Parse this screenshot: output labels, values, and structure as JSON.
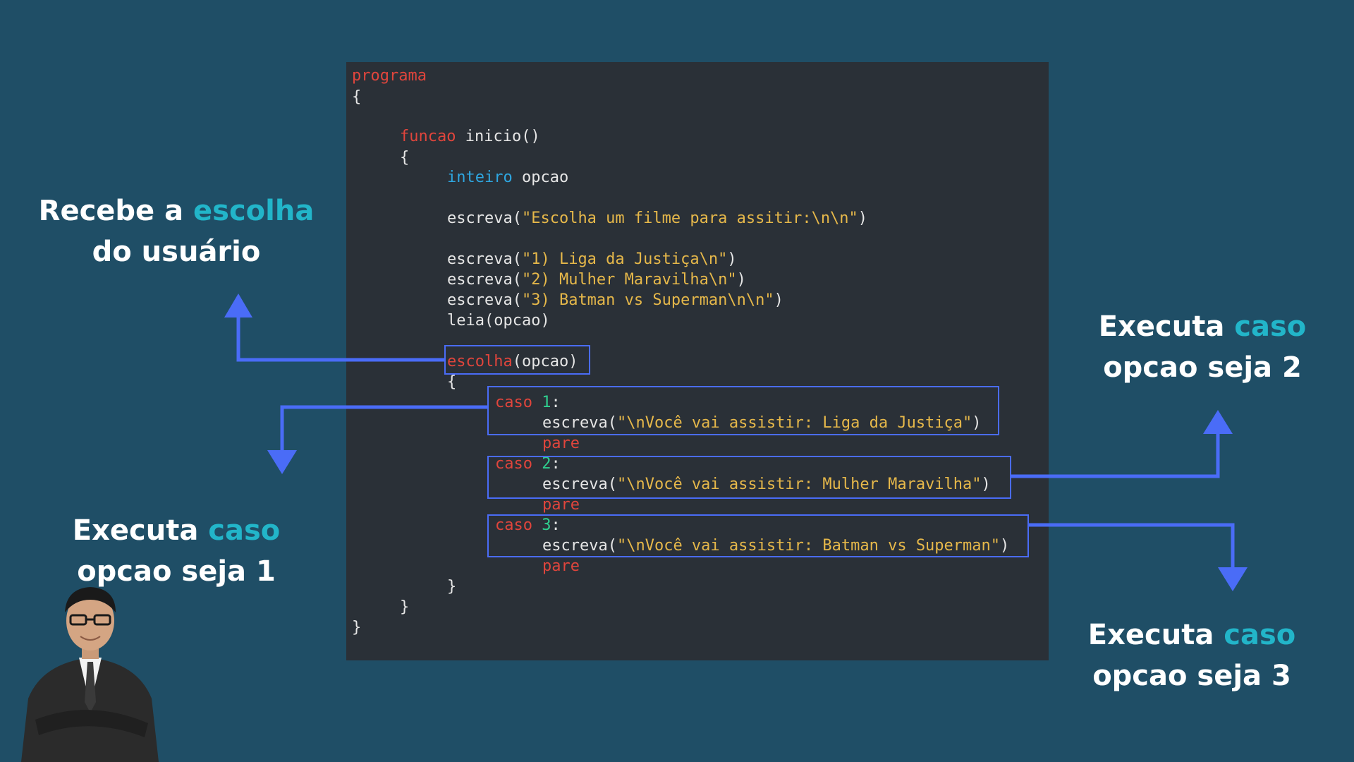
{
  "code": {
    "l1": "programa",
    "l2": "{",
    "l3_kw": "funcao",
    "l3_rest": " inicio()",
    "l4": "{",
    "l5_kw": "inteiro",
    "l5_rest": " opcao",
    "l6_fn": "escreva(",
    "l6_str": "\"Escolha um filme para assitir:\\n\\n\"",
    "l6_end": ")",
    "l7_fn": "escreva(",
    "l7_str": "\"1) Liga da Justiça\\n\"",
    "l7_end": ")",
    "l8_fn": "escreva(",
    "l8_str": "\"2) Mulher Maravilha\\n\"",
    "l8_end": ")",
    "l9_fn": "escreva(",
    "l9_str": "\"3) Batman vs Superman\\n\\n\"",
    "l9_end": ")",
    "l10": "leia(opcao)",
    "l11_kw": "escolha",
    "l11_rest": "(opcao)",
    "l12": "{",
    "case1_kw": "caso",
    "case1_num": "1",
    "case1_colon": ":",
    "case1_fn": "escreva(",
    "case1_str": "\"\\nVocê vai assistir: Liga da Justiça\"",
    "case1_end": ")",
    "pare1": "pare",
    "case2_kw": "caso",
    "case2_num": "2",
    "case2_colon": ":",
    "case2_fn": "escreva(",
    "case2_str": "\"\\nVocê vai assistir: Mulher Maravilha\"",
    "case2_end": ")",
    "pare2": "pare",
    "case3_kw": "caso",
    "case3_num": "3",
    "case3_colon": ":",
    "case3_fn": "escreva(",
    "case3_str": "\"\\nVocê vai assistir: Batman vs Superman\"",
    "case3_end": ")",
    "pare3": "pare",
    "close1": "}",
    "close2": "}",
    "close3": "}"
  },
  "labels": {
    "escolha": {
      "p1": "Recebe a ",
      "accent": "escolha",
      "p2": "do usuário"
    },
    "caso1": {
      "p1": "Executa ",
      "accent": "caso",
      "p2": "opcao seja 1"
    },
    "caso2": {
      "p1": "Executa ",
      "accent": "caso",
      "p2": "opcao seja 2"
    },
    "caso3": {
      "p1": "Executa ",
      "accent": "caso",
      "p2": "opcao seja 3"
    }
  },
  "colors": {
    "background": "#1f4e66",
    "code_background": "#2a3037",
    "keyword_red": "#e0453c",
    "keyword_blue": "#2ea6e0",
    "string": "#e6b84a",
    "number": "#2fd08f",
    "arrow": "#4a6cf7",
    "accent_text": "#22b5c9"
  },
  "icons": {
    "arrow": "arrow-icon",
    "presenter": "presenter-photo"
  }
}
